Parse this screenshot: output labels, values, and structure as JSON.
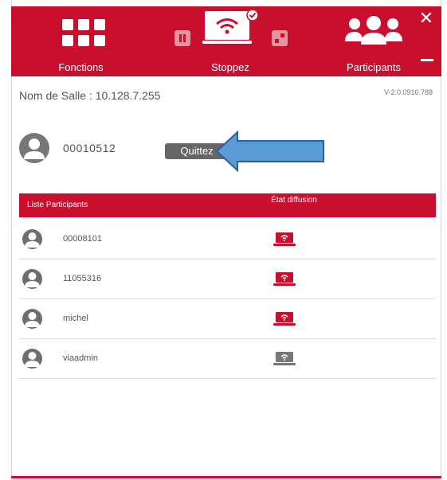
{
  "toolbar": {
    "functions_label": "Fonctions",
    "stop_label": "Stoppez",
    "participants_label": "Participants",
    "close_icon": "close-icon",
    "minimize_icon": "minimize-icon",
    "bar_color": "#c8102e"
  },
  "room": {
    "label": "Nom de Salle : 10.128.7.255",
    "version": "V-2.0.0916.788"
  },
  "self": {
    "id": "00010512",
    "quit_label": "Quittez"
  },
  "list": {
    "col_participants": "Liste Participants",
    "col_state": "État diffusion",
    "rows": [
      {
        "name": "00008101",
        "status": "broadcasting",
        "status_color": "#c8102e"
      },
      {
        "name": "11055316",
        "status": "broadcasting",
        "status_color": "#c8102e"
      },
      {
        "name": "michel",
        "status": "broadcasting",
        "status_color": "#c8102e"
      },
      {
        "name": "viaadmin",
        "status": "idle",
        "status_color": "#777777"
      }
    ]
  },
  "annotation": {
    "arrow_color": "#5b9bd5"
  }
}
